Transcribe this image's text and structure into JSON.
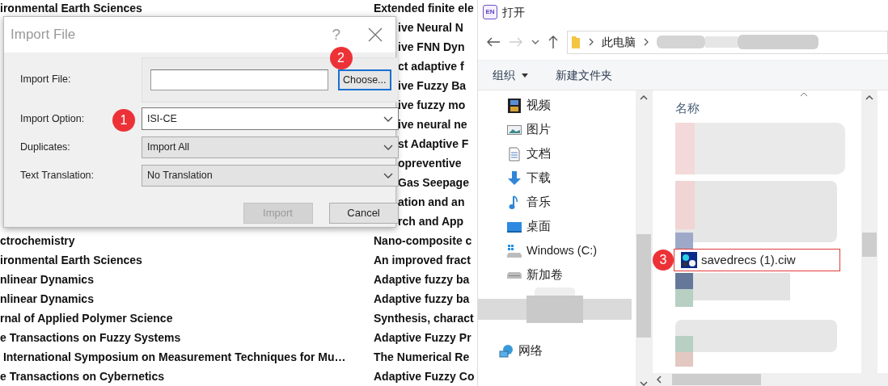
{
  "background_list": {
    "top_row": {
      "column_1": "ironmental Earth Sciences",
      "column_2": "Extended finite ele"
    },
    "beside_dialog": [
      "ive Neural N",
      "ive FNN Dyn",
      "ct adaptive f",
      "ive Fuzzy Ba",
      "ive fuzzy mo",
      "ive neural ne",
      "st Adaptive F",
      "opreventive",
      "Gas Seepage",
      "ation and an",
      "rch and App"
    ],
    "rows": [
      {
        "column_1": "ctrochemistry",
        "column_2": "Nano-composite c"
      },
      {
        "column_1": "ironmental Earth Sciences",
        "column_2": "An improved fract"
      },
      {
        "column_1": "nlinear Dynamics",
        "column_2": "Adaptive fuzzy ba"
      },
      {
        "column_1": "nlinear Dynamics",
        "column_2": "Adaptive fuzzy ba"
      },
      {
        "column_1": "rnal of Applied Polymer Science",
        "column_2": "Synthesis, charact"
      },
      {
        "column_1": "e Transactions on Fuzzy Systems",
        "column_2": "Adaptive Fuzzy Pr"
      },
      {
        "column_1": " International Symposium on Measurement Techniques for Mu…",
        "column_2": "The Numerical Re"
      },
      {
        "column_1": "e Transactions on Cybernetics",
        "column_2": "Adaptive Fuzzy Co"
      }
    ]
  },
  "import_dialog": {
    "title": "Import File",
    "help": "?",
    "fields": [
      {
        "label": "Import File:",
        "kind": "file",
        "button": "Choose...",
        "callout": "2"
      },
      {
        "label": "Import Option:",
        "kind": "combo-edit",
        "value": "ISI-CE",
        "callout": "1"
      },
      {
        "label": "Duplicates:",
        "kind": "combo",
        "value": "Import All"
      },
      {
        "label": "Text Translation:",
        "kind": "combo",
        "value": "No Translation"
      }
    ],
    "buttons": [
      {
        "label": "Import",
        "disabled": true
      },
      {
        "label": "Cancel",
        "disabled": false
      }
    ]
  },
  "open_dialog": {
    "app_icon_text": "EN",
    "title": "打开",
    "address": [
      "此电脑"
    ],
    "toolbar": [
      {
        "label": "组织",
        "kind": "menu"
      },
      {
        "label": "新建文件夹",
        "kind": "button"
      }
    ],
    "sidebar": [
      {
        "label": "视频",
        "kind": "video"
      },
      {
        "label": "图片",
        "kind": "picture"
      },
      {
        "label": "文档",
        "kind": "document"
      },
      {
        "label": "下载",
        "kind": "download"
      },
      {
        "label": "音乐",
        "kind": "music"
      },
      {
        "label": "桌面",
        "kind": "desktop"
      },
      {
        "label": "Windows (C:)",
        "kind": "system-drive"
      },
      {
        "label": "新加卷",
        "kind": "drive"
      },
      {
        "label": "网络",
        "kind": "network"
      }
    ],
    "column": "名称",
    "files": [
      {
        "name": "savedrecs (1).ciw",
        "callout": "3"
      }
    ]
  }
}
